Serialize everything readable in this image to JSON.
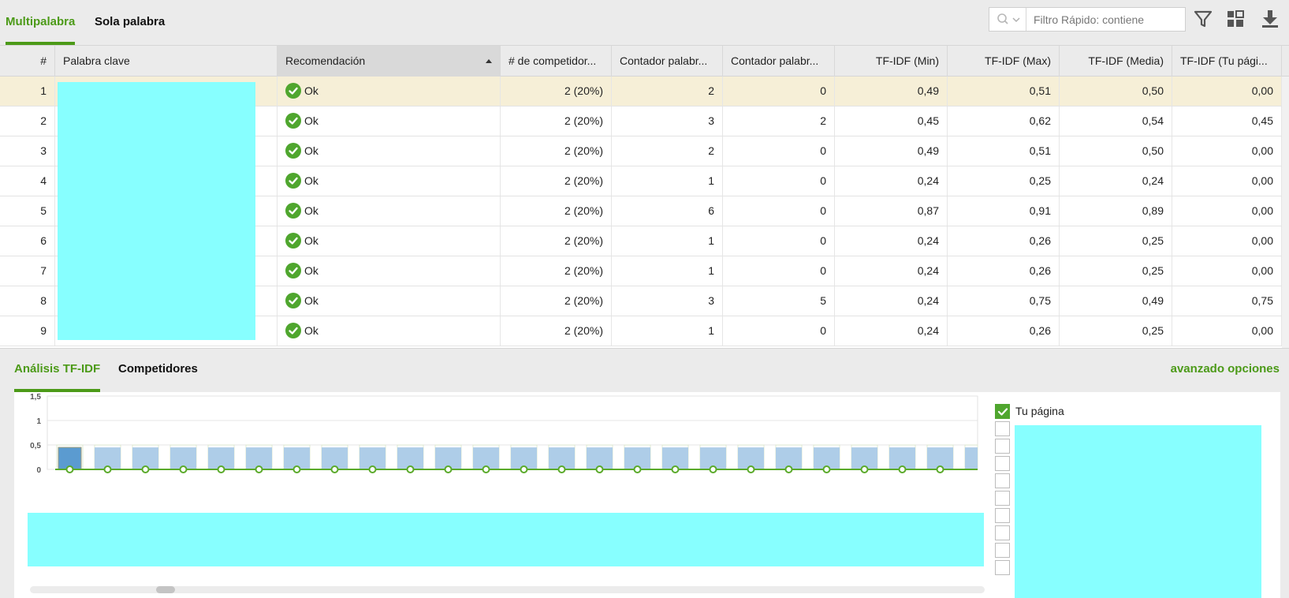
{
  "top_tabs": [
    {
      "label": "Multipalabra",
      "active": true
    },
    {
      "label": "Sola palabra",
      "active": false
    }
  ],
  "toolbar": {
    "filter_placeholder": "Filtro Rápido: contiene",
    "icons": [
      "search-icon",
      "chevron-down-icon",
      "filter-icon",
      "columns-grid-icon",
      "download-icon"
    ]
  },
  "grid": {
    "columns": [
      "#",
      "Palabra clave",
      "Recomendación",
      "# de competidor...",
      "Contador palabr...",
      "Contador palabr...",
      "TF-IDF (Min)",
      "TF-IDF (Max)",
      "TF-IDF (Media)",
      "TF-IDF (Tu pági..."
    ],
    "sorted_column": "Recomendación",
    "sort_direction": "ascending",
    "selected_row": 1,
    "rows": [
      {
        "n": "1",
        "rec": "Ok",
        "comp": "2 (20%)",
        "c1": "2",
        "c2": "0",
        "min": "0,49",
        "max": "0,51",
        "avg": "0,50",
        "you": "0,00"
      },
      {
        "n": "2",
        "rec": "Ok",
        "comp": "2 (20%)",
        "c1": "3",
        "c2": "2",
        "min": "0,45",
        "max": "0,62",
        "avg": "0,54",
        "you": "0,45"
      },
      {
        "n": "3",
        "rec": "Ok",
        "comp": "2 (20%)",
        "c1": "2",
        "c2": "0",
        "min": "0,49",
        "max": "0,51",
        "avg": "0,50",
        "you": "0,00"
      },
      {
        "n": "4",
        "rec": "Ok",
        "comp": "2 (20%)",
        "c1": "1",
        "c2": "0",
        "min": "0,24",
        "max": "0,25",
        "avg": "0,24",
        "you": "0,00"
      },
      {
        "n": "5",
        "rec": "Ok",
        "comp": "2 (20%)",
        "c1": "6",
        "c2": "0",
        "min": "0,87",
        "max": "0,91",
        "avg": "0,89",
        "you": "0,00"
      },
      {
        "n": "6",
        "rec": "Ok",
        "comp": "2 (20%)",
        "c1": "1",
        "c2": "0",
        "min": "0,24",
        "max": "0,26",
        "avg": "0,25",
        "you": "0,00"
      },
      {
        "n": "7",
        "rec": "Ok",
        "comp": "2 (20%)",
        "c1": "1",
        "c2": "0",
        "min": "0,24",
        "max": "0,26",
        "avg": "0,25",
        "you": "0,00"
      },
      {
        "n": "8",
        "rec": "Ok",
        "comp": "2 (20%)",
        "c1": "3",
        "c2": "5",
        "min": "0,24",
        "max": "0,75",
        "avg": "0,49",
        "you": "0,75"
      },
      {
        "n": "9",
        "rec": "Ok",
        "comp": "2 (20%)",
        "c1": "1",
        "c2": "0",
        "min": "0,24",
        "max": "0,26",
        "avg": "0,25",
        "you": "0,00"
      }
    ]
  },
  "bottom_tabs": [
    {
      "label": "Análisis TF-IDF",
      "active": true
    },
    {
      "label": "Competidores",
      "active": false
    }
  ],
  "advanced_options_label": "avanzado opciones",
  "legend": {
    "first_label": "Tu página",
    "item_count": 10
  },
  "colors": {
    "accent": "#4c9a18",
    "selected_row": "#f6efd7",
    "bar_light": "#aecde8",
    "bar_dark": "#5b9bd0",
    "line": "#5aaa2a",
    "redacted": "#87ffff"
  },
  "chart_data": {
    "type": "bar",
    "title": "",
    "xlabel": "",
    "ylabel": "",
    "ylim": [
      0,
      1.5
    ],
    "y_ticks": [
      "0",
      "0,5",
      "1",
      "1,5"
    ],
    "grid": true,
    "legend_position": "right",
    "categories_visible": false,
    "series": [
      {
        "values": [
          0.45,
          0.45,
          0.45,
          0.45,
          0.45,
          0.45,
          0.45,
          0.45,
          0.45,
          0.45,
          0.45,
          0.45,
          0.45,
          0.45,
          0.45,
          0.45,
          0.45,
          0.45,
          0.45,
          0.45,
          0.45,
          0.45,
          0.45,
          0.45,
          0.45
        ]
      },
      {
        "name": "Tu página",
        "values": [
          0,
          0,
          0,
          0,
          0,
          0,
          0,
          0,
          0,
          0,
          0,
          0,
          0,
          0,
          0,
          0,
          0,
          0,
          0,
          0,
          0,
          0,
          0,
          0,
          0
        ]
      }
    ],
    "highlighted_index": 0
  }
}
